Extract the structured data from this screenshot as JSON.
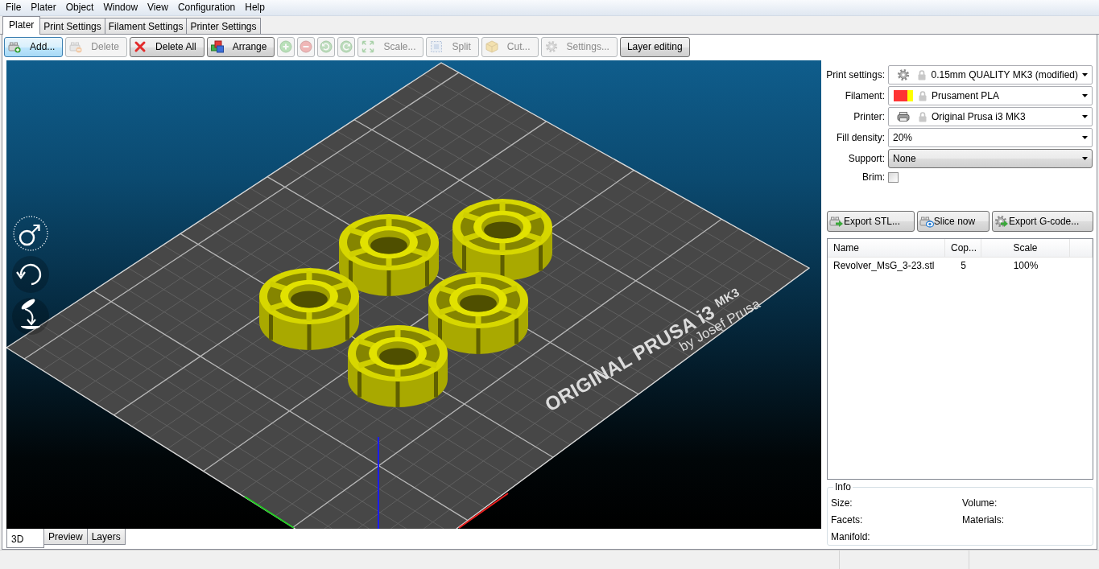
{
  "menu": [
    "File",
    "Plater",
    "Object",
    "Window",
    "View",
    "Configuration",
    "Help"
  ],
  "tabs": [
    {
      "label": "Plater",
      "selected": true
    },
    {
      "label": "Print Settings",
      "selected": false
    },
    {
      "label": "Filament Settings",
      "selected": false
    },
    {
      "label": "Printer Settings",
      "selected": false
    }
  ],
  "toolbar": [
    {
      "kind": "add",
      "label": "Add...",
      "disabled": false,
      "highlighted": true
    },
    {
      "kind": "delete",
      "label": "Delete",
      "disabled": true,
      "highlighted": false
    },
    {
      "kind": "delete-all",
      "label": "Delete All",
      "disabled": false,
      "highlighted": false
    },
    {
      "kind": "arrange",
      "label": "Arrange",
      "disabled": false,
      "highlighted": false
    },
    {
      "kind": "increase",
      "disabled": true,
      "highlighted": false
    },
    {
      "kind": "decrease",
      "disabled": true,
      "highlighted": false
    },
    {
      "kind": "rotate-left",
      "disabled": true,
      "highlighted": false
    },
    {
      "kind": "rotate-right",
      "disabled": true,
      "highlighted": false
    },
    {
      "kind": "scale",
      "label": "Scale...",
      "disabled": true,
      "highlighted": false
    },
    {
      "kind": "split",
      "label": "Split",
      "disabled": true,
      "highlighted": false
    },
    {
      "kind": "cut",
      "label": "Cut...",
      "disabled": true,
      "highlighted": false
    },
    {
      "kind": "settings",
      "label": "Settings...",
      "disabled": true,
      "highlighted": false
    },
    {
      "kind": "layer-editing",
      "label": "Layer editing",
      "disabled": false,
      "highlighted": false
    }
  ],
  "viewport": {
    "bed_logo": {
      "title": "ORIGINAL PRUSA i3",
      "model": "MK3",
      "byline": "by Josef Prusa"
    }
  },
  "view_tabs": [
    {
      "label": "3D",
      "selected": true
    },
    {
      "label": "Preview",
      "selected": false
    },
    {
      "label": "Layers",
      "selected": false
    }
  ],
  "sidebar": {
    "settings": [
      {
        "kind": "print",
        "label": "Print settings:",
        "value": "0.15mm QUALITY MK3 (modified)"
      },
      {
        "kind": "filament",
        "label": "Filament:",
        "value": "Prusament PLA",
        "swatches": [
          {
            "color": "#ff3333"
          },
          {
            "color": "#ffff00"
          }
        ]
      },
      {
        "kind": "printer",
        "label": "Printer:",
        "value": "Original Prusa i3 MK3"
      },
      {
        "kind": "combo",
        "label": "Fill density:",
        "value": "20%"
      },
      {
        "kind": "choice",
        "label": "Support:",
        "value": "None"
      },
      {
        "kind": "checkbox",
        "label": "Brim:",
        "checked": false
      }
    ],
    "actions": [
      {
        "kind": "export-stl",
        "label": "Export STL..."
      },
      {
        "kind": "slice",
        "label": "Slice now"
      },
      {
        "kind": "export-gcode",
        "label": "Export G-code..."
      }
    ],
    "objects": {
      "columns": [
        "Name",
        "Cop...",
        "Scale"
      ],
      "rows": [
        {
          "cells": [
            "Revolver_MsG_3-23.stl",
            "5",
            "100%"
          ],
          "selected": false
        }
      ]
    },
    "info": {
      "title": "Info",
      "labels": [
        "Size:",
        "Volume:",
        "Facets:",
        "Materials:",
        "Manifold:"
      ]
    }
  }
}
